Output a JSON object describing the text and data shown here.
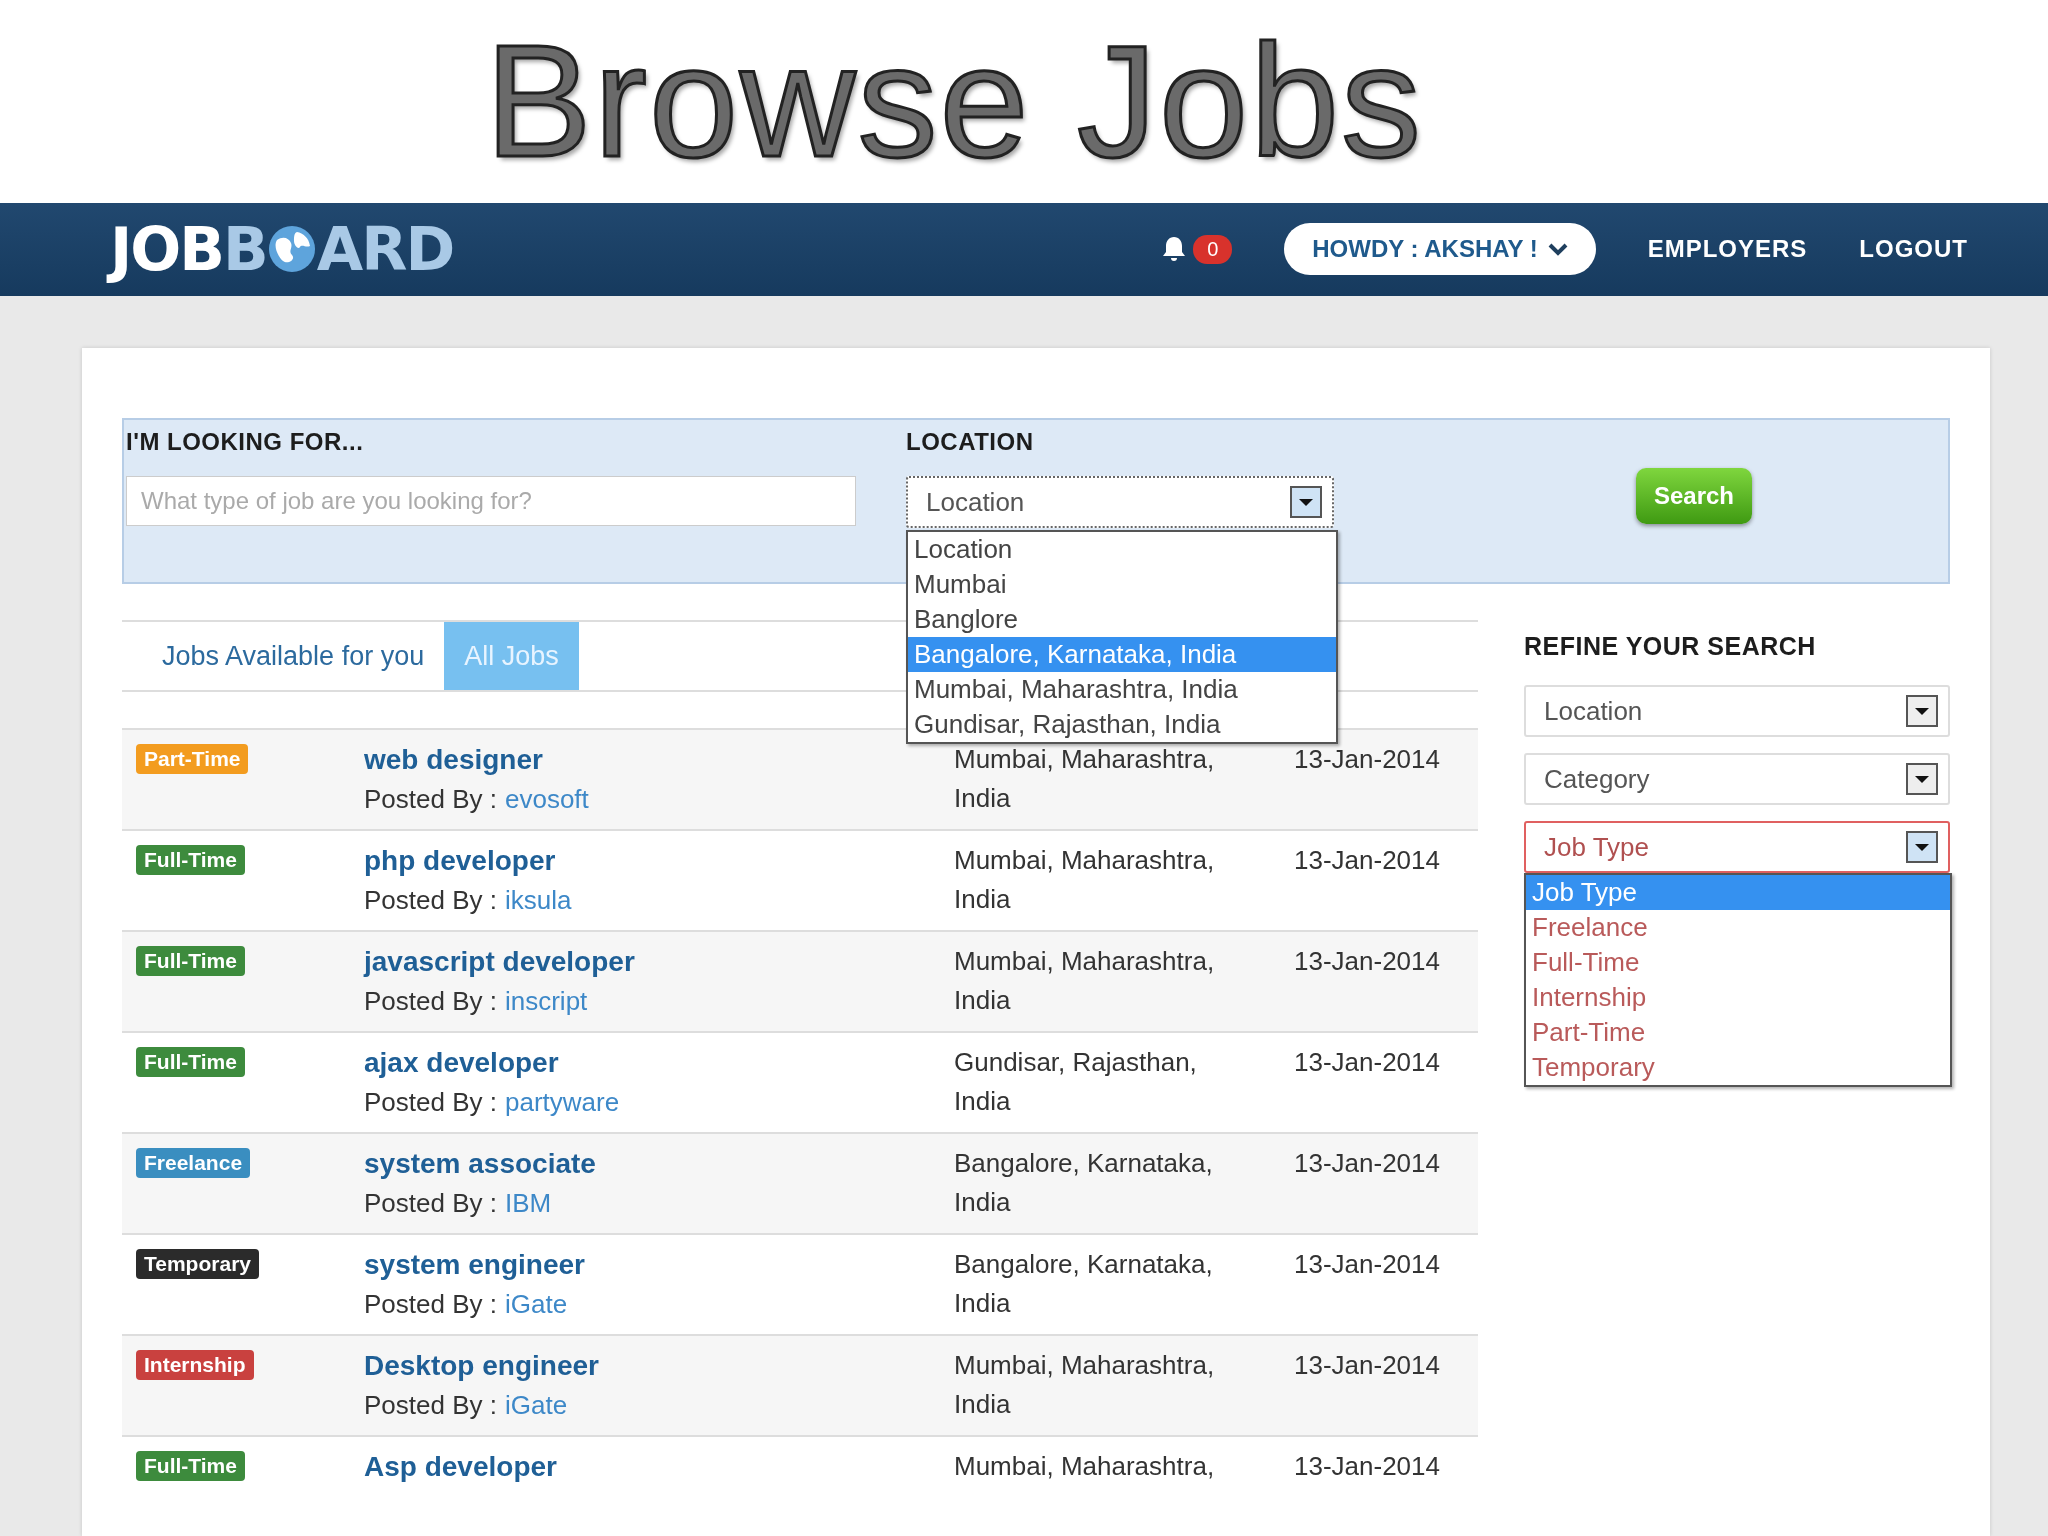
{
  "slide_title": "Browse Jobs",
  "navbar": {
    "logo_start": "JOBB",
    "logo_end": "ARD",
    "notifications": "0",
    "user_menu": "HOWDY : AKSHAY !",
    "links": [
      "EMPLOYERS",
      "LOGOUT"
    ]
  },
  "search": {
    "keyword_label": "I'M LOOKING FOR...",
    "keyword_placeholder": "What type of job are you looking for?",
    "location_label": "LOCATION",
    "location_value": "Location",
    "location_open": true,
    "location_options": [
      {
        "label": "Location",
        "selected": false
      },
      {
        "label": "Mumbai",
        "selected": false
      },
      {
        "label": "Banglore",
        "selected": false
      },
      {
        "label": "Bangalore, Karnataka, India",
        "selected": true
      },
      {
        "label": "Mumbai, Maharashtra, India",
        "selected": false
      },
      {
        "label": "Gundisar, Rajasthan, India",
        "selected": false
      }
    ],
    "button": "Search"
  },
  "tabs": [
    {
      "label": "Jobs Available for you",
      "selected": false
    },
    {
      "label": "All Jobs",
      "selected": true
    }
  ],
  "jobs": [
    {
      "type": "Part-Time",
      "color": "#f39c1f",
      "title": "web designer",
      "posted_label": "Posted By :",
      "company": "evosoft",
      "location": [
        "Mumbai, Maharashtra,",
        "India"
      ],
      "date": "13-Jan-2014"
    },
    {
      "type": "Full-Time",
      "color": "#3d8b3d",
      "title": "php developer",
      "posted_label": "Posted By :",
      "company": "iksula",
      "location": [
        "Mumbai, Maharashtra,",
        "India"
      ],
      "date": "13-Jan-2014"
    },
    {
      "type": "Full-Time",
      "color": "#3d8b3d",
      "title": "javascript developer",
      "posted_label": "Posted By :",
      "company": "inscript",
      "location": [
        "Mumbai, Maharashtra,",
        "India"
      ],
      "date": "13-Jan-2014"
    },
    {
      "type": "Full-Time",
      "color": "#3d8b3d",
      "title": "ajax developer",
      "posted_label": "Posted By :",
      "company": "partyware",
      "location": [
        "Gundisar, Rajasthan,",
        "India"
      ],
      "date": "13-Jan-2014"
    },
    {
      "type": "Freelance",
      "color": "#3a8ec0",
      "title": "system associate",
      "posted_label": "Posted By :",
      "company": "IBM",
      "location": [
        "Bangalore, Karnataka,",
        "India"
      ],
      "date": "13-Jan-2014"
    },
    {
      "type": "Temporary",
      "color": "#2b2b2b",
      "title": "system engineer",
      "posted_label": "Posted By :",
      "company": "iGate",
      "location": [
        "Bangalore, Karnataka,",
        "India"
      ],
      "date": "13-Jan-2014"
    },
    {
      "type": "Internship",
      "color": "#c9413f",
      "title": "Desktop engineer",
      "posted_label": "Posted By :",
      "company": "iGate",
      "location": [
        "Mumbai, Maharashtra,",
        "India"
      ],
      "date": "13-Jan-2014"
    },
    {
      "type": "Full-Time",
      "color": "#3d8b3d",
      "title": "Asp developer",
      "location": [
        "Mumbai, Maharashtra,"
      ],
      "date": "13-Jan-2014"
    }
  ],
  "refine": {
    "title": "REFINE YOUR SEARCH",
    "filters": [
      {
        "value": "Location",
        "open": false
      },
      {
        "value": "Category",
        "open": false
      },
      {
        "value": "Job Type",
        "open": true,
        "options": [
          {
            "label": "Job Type",
            "selected": true
          },
          {
            "label": "Freelance",
            "selected": false
          },
          {
            "label": "Full-Time",
            "selected": false
          },
          {
            "label": "Internship",
            "selected": false
          },
          {
            "label": "Part-Time",
            "selected": false
          },
          {
            "label": "Temporary",
            "selected": false
          }
        ]
      }
    ]
  }
}
